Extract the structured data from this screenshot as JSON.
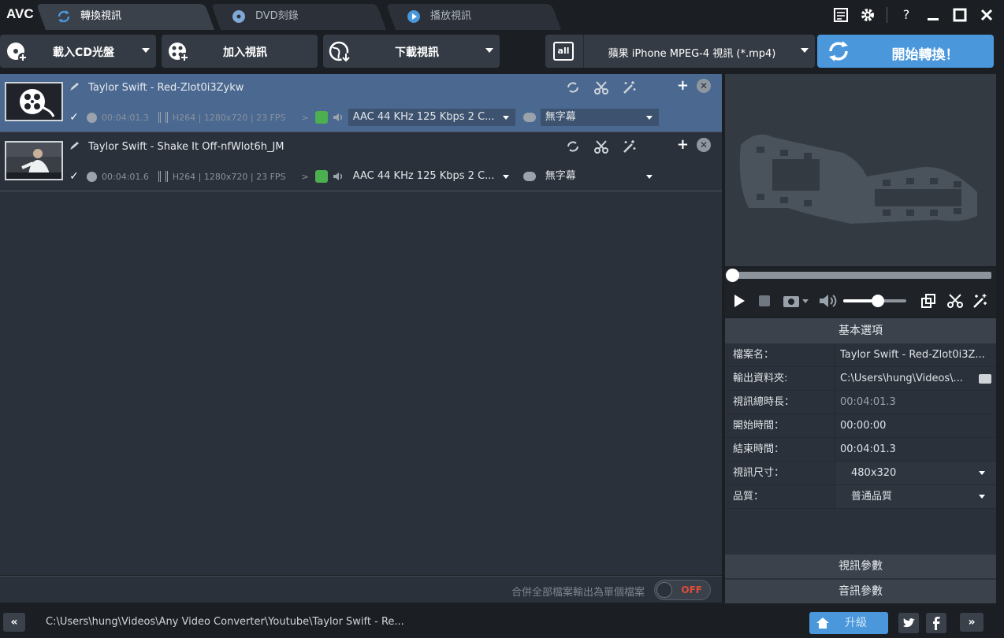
{
  "app": {
    "logo": "AVC"
  },
  "tabs": [
    {
      "label": "轉換視訊",
      "icon": "refresh-icon",
      "active": true
    },
    {
      "label": "DVD刻錄",
      "icon": "disc-icon",
      "active": false
    },
    {
      "label": "播放視訊",
      "icon": "play-icon",
      "active": false
    }
  ],
  "toolbar": {
    "load_cd_label": "載入CD光盤",
    "add_video_label": "加入視訊",
    "download_video_label": "下載視訊",
    "profile_icon_text": "all",
    "profile_label": "蘋果 iPhone MPEG-4 視訊 (*.mp4)",
    "convert_label": "開始轉換！"
  },
  "files": [
    {
      "name": "Taylor Swift - Red-Zlot0i3Zykw",
      "duration": "00:04:01.3",
      "video_info": "H264 | 1280x720 | 23 FPS",
      "audio": "AAC 44 KHz 125 Kbps 2 C...",
      "subtitle": "無字幕",
      "checked": true,
      "selected": true
    },
    {
      "name": "Taylor Swift - Shake It Off-nfWlot6h_JM",
      "duration": "00:04:01.6",
      "video_info": "H264 | 1280x720 | 23 FPS",
      "audio": "AAC 44 KHz 125 Kbps 2 C...",
      "subtitle": "無字幕",
      "checked": true,
      "selected": false
    }
  ],
  "merge": {
    "label": "合併全部檔案輸出為單個檔案",
    "toggle": "OFF"
  },
  "player": {
    "seek_position": 0.0,
    "volume": 0.55
  },
  "props": {
    "header": "基本選項",
    "rows": [
      {
        "key": "檔案名：",
        "value": "Taylor Swift - Red-Zlot0i3Z..."
      },
      {
        "key": "輸出資料夾:",
        "value": "C:\\Users\\hung\\Videos\\..."
      },
      {
        "key": "視訊總時長：",
        "value": "00:04:01.3"
      },
      {
        "key": "開始時間：",
        "value": "00:00:00"
      },
      {
        "key": "結束時間：",
        "value": "00:04:01.3"
      },
      {
        "key": "視訊尺寸：",
        "value": "480x320"
      },
      {
        "key": "品質：",
        "value": "普通品質"
      }
    ],
    "video_params": "視訊參數",
    "audio_params": "音訊參數"
  },
  "status": {
    "path": "C:\\Users\\hung\\Videos\\Any Video Converter\\Youtube\\Taylor Swift - Re...",
    "upgrade_label": "升級",
    "collapse_symbol": "«",
    "expand_symbol": "»"
  },
  "colors": {
    "accent": "#4a97dc",
    "selected_row": "#4a6890",
    "toggle_off": "#e04a3a"
  }
}
